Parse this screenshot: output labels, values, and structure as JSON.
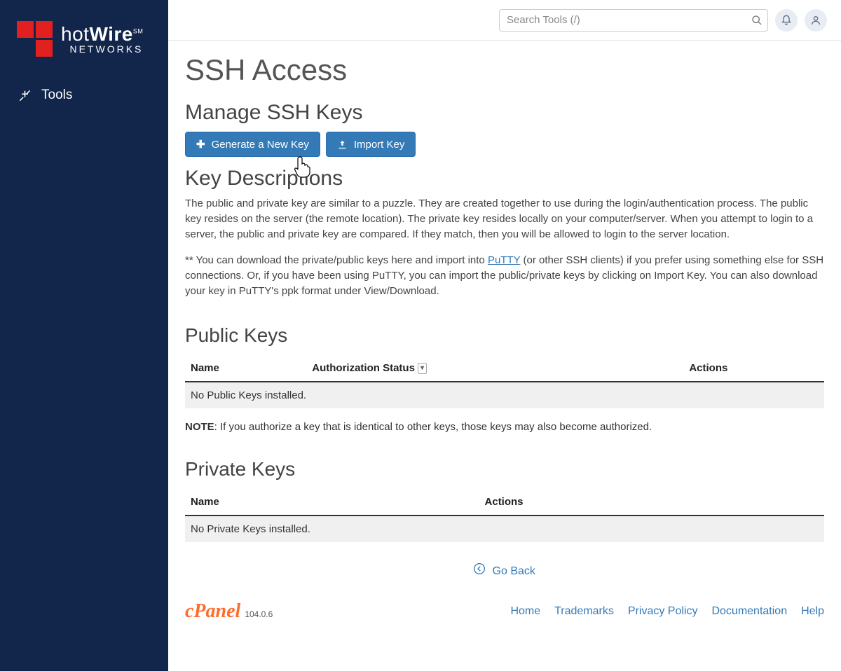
{
  "sidebar": {
    "logo_line1_a": "hot",
    "logo_line1_b": "Wire",
    "logo_sm": "SM",
    "logo_line2": "NETWORKS",
    "tools_label": "Tools"
  },
  "topbar": {
    "search_placeholder": "Search Tools (/)"
  },
  "page": {
    "title": "SSH Access",
    "manage_title": "Manage SSH Keys",
    "btn_generate": "Generate a New Key",
    "btn_import": "Import Key",
    "desc_title": "Key Descriptions",
    "desc_p1": "The public and private key are similar to a puzzle. They are created together to use during the login/authentication process. The public key resides on the server (the remote location). The private key resides locally on your computer/server. When you attempt to login to a server, the public and private key are compared. If they match, then you will be allowed to login to the server location.",
    "desc_p2_a": "** You can download the private/public keys here and import into ",
    "desc_p2_link": "PuTTY",
    "desc_p2_b": " (or other SSH clients) if you prefer using something else for SSH connections. Or, if you have been using PuTTY, you can import the public/private keys by clicking on Import Key. You can also download your key in PuTTY's ppk format under View/Download.",
    "public_title": "Public Keys",
    "public_cols": {
      "name": "Name",
      "auth": "Authorization Status",
      "actions": "Actions"
    },
    "public_empty": "No Public Keys installed.",
    "note_label": "NOTE",
    "note_text": ": If you authorize a key that is identical to other keys, those keys may also become authorized.",
    "private_title": "Private Keys",
    "private_cols": {
      "name": "Name",
      "actions": "Actions"
    },
    "private_empty": "No Private Keys installed.",
    "go_back": "Go Back"
  },
  "footer": {
    "brand": "cPanel",
    "version": "104.0.6",
    "links": [
      "Home",
      "Trademarks",
      "Privacy Policy",
      "Documentation",
      "Help"
    ]
  }
}
